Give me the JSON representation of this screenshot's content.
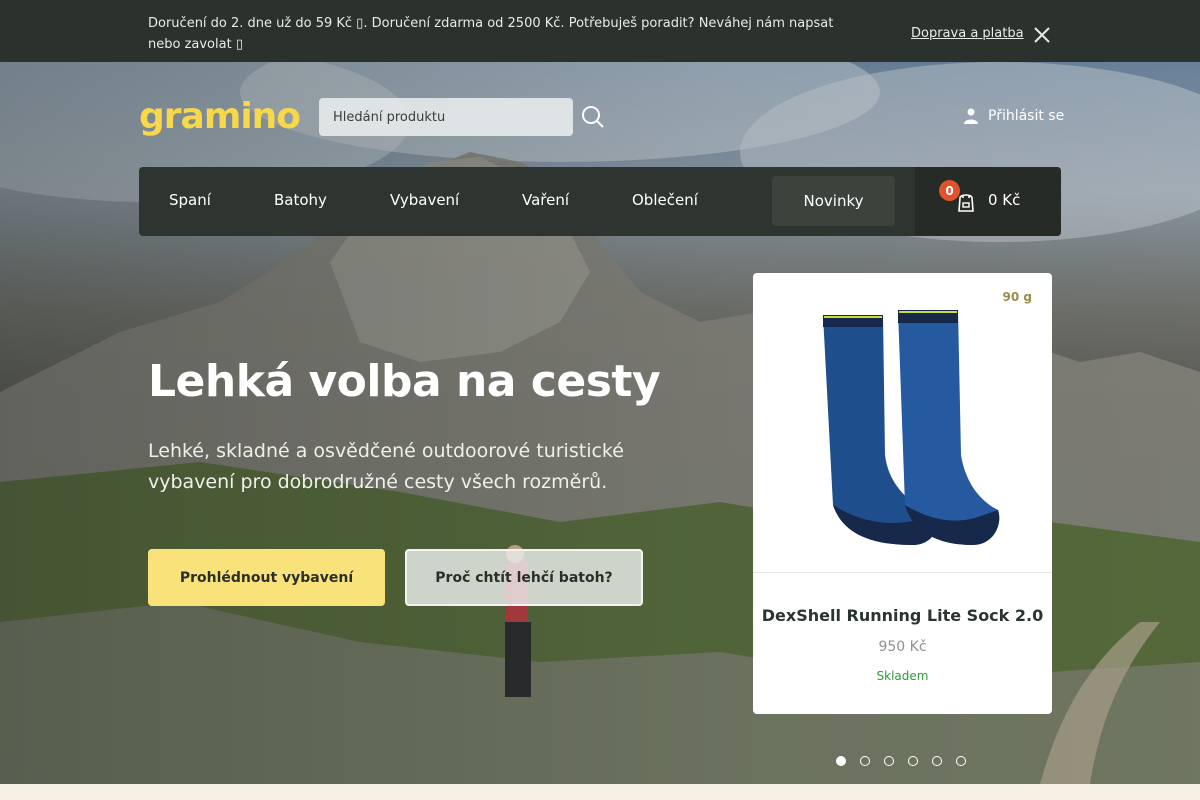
{
  "topbar": {
    "message": "Doručení do 2. dne už do 59 Kč ▯. Doručení zdarma od 2500 Kč. Potřebuješ poradit? Neváhej nám napsat nebo zavolat ▯",
    "link": "Doprava a platba",
    "close_icon": "close-icon"
  },
  "header": {
    "logo": "gramino",
    "search_placeholder": "Hledání produktu",
    "login_label": "Přihlásit se"
  },
  "nav": {
    "items": [
      "Spaní",
      "Batohy",
      "Vybavení",
      "Vaření",
      "Oblečení"
    ],
    "novinky": "Novinky",
    "cart_count": "0",
    "cart_total": "0 Kč"
  },
  "hero": {
    "headline": "Lehká volba na cesty",
    "subtitle": "Lehké, skladné a osvědčené outdoorové turistické vybavení pro dobrodružné cesty všech rozměrů.",
    "primary_button": "Prohlédnout vybavení",
    "secondary_button": "Proč chtít lehčí batoh?"
  },
  "product": {
    "weight": "90 g",
    "name": "DexShell Running Lite Sock 2.0",
    "price": "950 Kč",
    "stock": "Skladem"
  },
  "carousel": {
    "count": 6,
    "active": 0
  },
  "colors": {
    "accent": "#f9e27a",
    "logo": "#f7d84a",
    "badge": "#e0522c",
    "stock": "#2f9a3a",
    "dark": "#2b312c"
  }
}
